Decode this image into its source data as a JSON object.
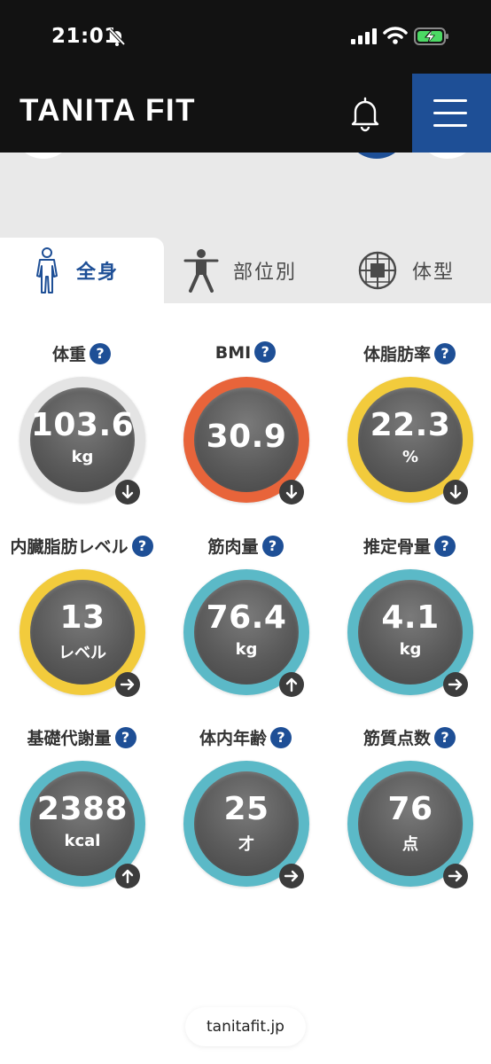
{
  "status_bar": {
    "time": "21:01"
  },
  "header": {
    "logo": "TANITA FIT"
  },
  "tabs": [
    {
      "label": "全身",
      "active": true
    },
    {
      "label": "部位別",
      "active": false
    },
    {
      "label": "体型",
      "active": false
    }
  ],
  "metrics": [
    {
      "title": "体重",
      "value": "103.6",
      "unit": "kg",
      "ring_color": "#e4e4e4",
      "arrow": "down"
    },
    {
      "title": "BMI",
      "value": "30.9",
      "unit": "",
      "ring_color": "#e8643a",
      "arrow": "down"
    },
    {
      "title": "体脂肪率",
      "value": "22.3",
      "unit": "%",
      "ring_color": "#f2cb3c",
      "arrow": "down"
    },
    {
      "title": "内臓脂肪レベル",
      "value": "13",
      "unit": "レベル",
      "ring_color": "#f2cb3c",
      "arrow": "right"
    },
    {
      "title": "筋肉量",
      "value": "76.4",
      "unit": "kg",
      "ring_color": "#5bb9c7",
      "arrow": "up"
    },
    {
      "title": "推定骨量",
      "value": "4.1",
      "unit": "kg",
      "ring_color": "#5bb9c7",
      "arrow": "right"
    },
    {
      "title": "基礎代謝量",
      "value": "2388",
      "unit": "kcal",
      "ring_color": "#5bb9c7",
      "arrow": "up"
    },
    {
      "title": "体内年齢",
      "value": "25",
      "unit": "才",
      "ring_color": "#5bb9c7",
      "arrow": "right"
    },
    {
      "title": "筋質点数",
      "value": "76",
      "unit": "点",
      "ring_color": "#5bb9c7",
      "arrow": "right"
    }
  ],
  "help_glyph": "?",
  "footer": {
    "url": "tanitafit.jp"
  },
  "colors": {
    "brand_blue": "#1e4f96",
    "header_bg": "#121212",
    "gray_bg": "#e9e9e9"
  }
}
